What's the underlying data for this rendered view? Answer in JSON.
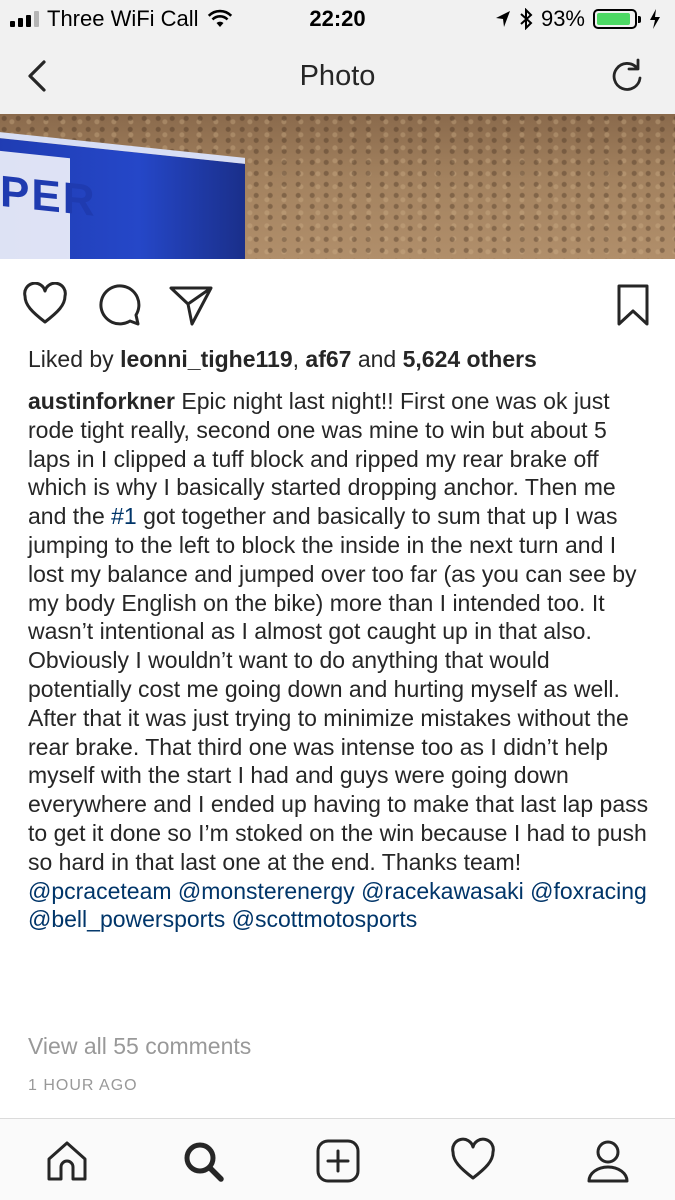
{
  "status": {
    "carrier": "Three WiFi Call",
    "time": "22:20",
    "battery": "93%",
    "battery_level": 0.93,
    "icons": [
      "signal-icon",
      "wifi-icon",
      "location-icon",
      "bluetooth-icon",
      "battery-icon",
      "charging-icon"
    ]
  },
  "nav": {
    "title": "Photo",
    "back_icon": "chevron-left-icon",
    "refresh_icon": "refresh-icon"
  },
  "actions": {
    "icons": [
      "heart-icon",
      "comment-icon",
      "share-icon",
      "bookmark-icon"
    ]
  },
  "likes": {
    "prefix": "Liked by ",
    "user1": "leonni_tighe119",
    "separator": ", ",
    "user2": "af67",
    "connector": " and ",
    "others": "5,624 others"
  },
  "caption": {
    "username": "austinforkner",
    "text1": " Epic night last night!! First one was ok just rode tight really, second one was mine to win but about 5 laps in I clipped a tuff block and ripped my rear brake off which is why I basically started dropping anchor. Then me and the ",
    "hashtag": "#1",
    "text2": " got together and basically to sum that up I was jumping to the left to block the inside in the next turn and I lost my balance and jumped over too far (as you can see by my body English on the bike) more than I intended too. It wasn’t intentional as I almost got caught up in that also. Obviously I wouldn’t want to do anything that would potentially cost me going down and hurting myself as well. After that it was just trying to minimize mistakes without the rear brake. That third one was intense too as I didn’t help myself with the start I had and guys were going down everywhere and I ended up having to make that last lap pass to get it done so I’m stoked on the win because I had to push so hard in that last one at the end. Thanks team! ",
    "mentions": [
      "@pcraceteam",
      "@monsterenergy",
      "@racekawasaki",
      "@foxracing",
      "@bell_powersports",
      "@scottmotosports"
    ]
  },
  "comments_link": "View all 55 comments",
  "time_ago": "1 HOUR AGO",
  "photo": {
    "barrier_text": "PER"
  },
  "tabbar": {
    "icons": [
      "home-icon",
      "search-icon",
      "add-post-icon",
      "activity-heart-icon",
      "profile-icon"
    ]
  },
  "colors": {
    "link": "#003569",
    "muted": "#999999",
    "text": "#262626",
    "battery_green": "#4cd964"
  }
}
